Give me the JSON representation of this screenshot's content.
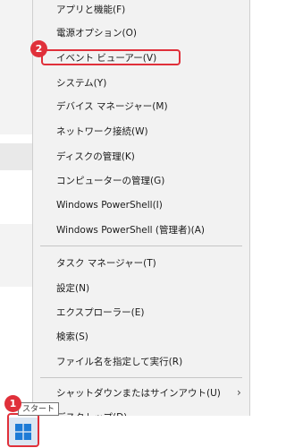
{
  "menu": {
    "group1": [
      {
        "label": "アプリと機能(F)"
      },
      {
        "label": "電源オプション(O)"
      },
      {
        "label": "イベント ビューアー(V)"
      },
      {
        "label": "システム(Y)"
      },
      {
        "label": "デバイス マネージャー(M)"
      },
      {
        "label": "ネットワーク接続(W)"
      },
      {
        "label": "ディスクの管理(K)"
      },
      {
        "label": "コンピューターの管理(G)"
      },
      {
        "label": "Windows PowerShell(I)"
      },
      {
        "label": "Windows PowerShell (管理者)(A)"
      }
    ],
    "group2": [
      {
        "label": "タスク マネージャー(T)"
      },
      {
        "label": "設定(N)"
      },
      {
        "label": "エクスプローラー(E)"
      },
      {
        "label": "検索(S)"
      },
      {
        "label": "ファイル名を指定して実行(R)"
      }
    ],
    "group3": [
      {
        "label": "シャットダウンまたはサインアウト(U)",
        "submenu_arrow": "›"
      },
      {
        "label": "デスクトップ(D)"
      }
    ]
  },
  "annotations": {
    "badge1": "1",
    "badge2": "2"
  },
  "tooltip": {
    "text": "スタート"
  },
  "colors": {
    "annotation_red": "#e0303a",
    "menu_background": "#f2f2f2"
  },
  "icons": {
    "start": "windows-logo-icon"
  }
}
